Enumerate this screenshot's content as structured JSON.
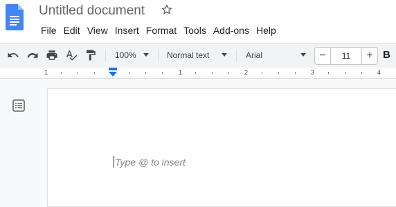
{
  "app": {
    "title": "Untitled document",
    "brand_color": "#4285f4"
  },
  "menu": [
    "File",
    "Edit",
    "View",
    "Insert",
    "Format",
    "Tools",
    "Add-ons",
    "Help"
  ],
  "toolbar": {
    "icons": [
      "undo-icon",
      "redo-icon",
      "print-icon",
      "spellcheck-icon",
      "paint-format-icon"
    ],
    "zoom": "100%",
    "style": "Normal text",
    "font": "Arial",
    "font_size": "11",
    "minus": "−",
    "plus": "+",
    "bold": "B"
  },
  "ruler": {
    "numbers": [
      "1",
      "1",
      "2",
      "3",
      "4"
    ]
  },
  "editor": {
    "placeholder": "Type @ to insert"
  }
}
